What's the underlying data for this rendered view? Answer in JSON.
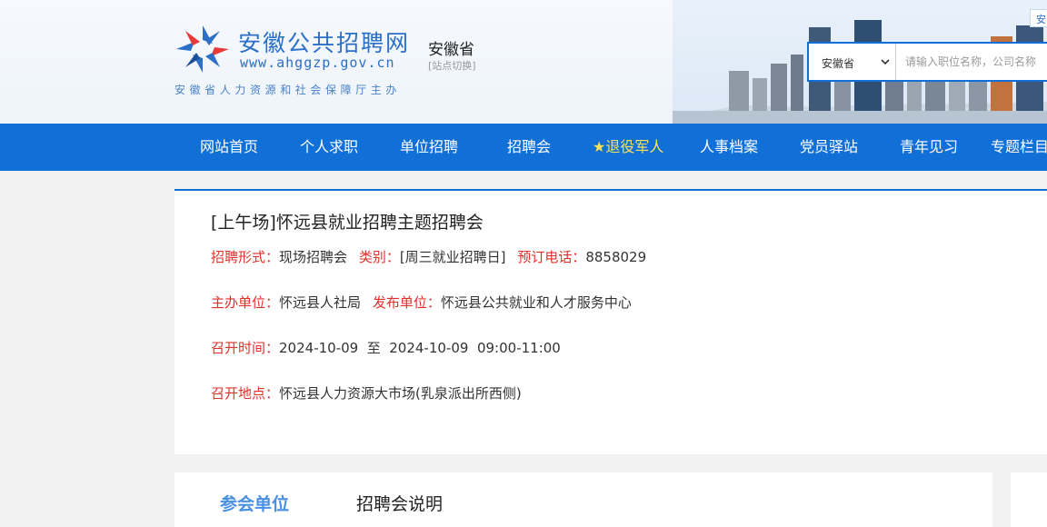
{
  "header": {
    "logo_title": "安徽公共招聘网",
    "logo_url": "www.ahggzp.gov.cn",
    "site_name": "安徽省",
    "site_switch": "[站点切换]",
    "sponsor": "安徽省人力资源和社会保障厅主办",
    "top_tag": "安",
    "region_selected": "安徽省",
    "search_placeholder": "请输入职位名称，公司名称",
    "brand_color": "#1170d8"
  },
  "nav": {
    "items": [
      {
        "label": "网站首页"
      },
      {
        "label": "个人求职"
      },
      {
        "label": "单位招聘"
      },
      {
        "label": "招聘会"
      },
      {
        "label": "★退役军人"
      },
      {
        "label": "人事档案"
      },
      {
        "label": "党员驿站"
      },
      {
        "label": "青年见习"
      },
      {
        "label": "专题栏目"
      }
    ]
  },
  "fair": {
    "title": "[上午场]怀远县就业招聘主题招聘会",
    "form_label": "招聘形式：",
    "form_value": "现场招聘会",
    "category_label": "类别：",
    "category_value": "[周三就业招聘日]",
    "phone_label": "预订电话：",
    "phone_value": "8858029",
    "host_label": "主办单位：",
    "host_value": "怀远县人社局",
    "publisher_label": "发布单位：",
    "publisher_value": "怀远县公共就业和人才服务中心",
    "time_label": "召开时间：",
    "time_value": "2024-10-09  至  2024-10-09  09:00-11:00",
    "place_label": "召开地点：",
    "place_value": "怀远县人力资源大市场(乳泉派出所西侧)"
  },
  "tabs": {
    "participants": "参会单位",
    "description": "招聘会说明"
  }
}
